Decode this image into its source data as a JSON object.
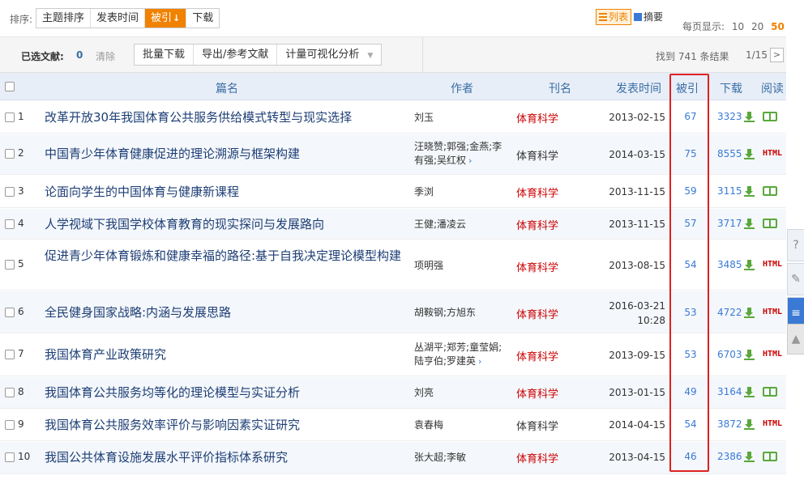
{
  "sortbar": {
    "label": "排序:",
    "buttons": [
      {
        "label": "主题排序",
        "active": false
      },
      {
        "label": "发表时间",
        "active": false
      },
      {
        "label": "被引",
        "active": true,
        "arrow": "↓"
      },
      {
        "label": "下载",
        "active": false
      }
    ],
    "view_list": "列表",
    "view_abstract": "摘要",
    "per_page_label": "每页显示:",
    "per_page_options": [
      "10",
      "20",
      "50"
    ],
    "per_page_selected": "50"
  },
  "selbar": {
    "selected_label": "已选文献:",
    "selected_count": "0",
    "clear": "清除",
    "actions": [
      "批量下载",
      "导出/参考文献",
      "计量可视化分析"
    ],
    "found": "找到 741 条结果",
    "page": "1/15",
    "next": ">"
  },
  "table": {
    "headers": {
      "title": "篇名",
      "author": "作者",
      "journal": "刊名",
      "date": "发表时间",
      "cited": "被引",
      "download": "下载",
      "read": "阅读"
    },
    "rows": [
      {
        "num": "1",
        "title": "改革开放30年我国体育公共服务供给模式转型与现实选择",
        "authors": "刘玉",
        "journal": "体育科学",
        "journal_red": true,
        "date": "2013-02-15",
        "cited": "67",
        "downloads": "3323",
        "read": "book"
      },
      {
        "num": "2",
        "title": "中国青少年体育健康促进的理论溯源与框架构建",
        "authors": "汪晓赞;郭强;金燕;李有强;吴红权",
        "more": true,
        "journal": "体育科学",
        "journal_red": false,
        "date": "2014-03-15",
        "cited": "75",
        "downloads": "8555",
        "read": "HTML"
      },
      {
        "num": "3",
        "title": "论面向学生的中国体育与健康新课程",
        "authors": "季浏",
        "journal": "体育科学",
        "journal_red": true,
        "date": "2013-11-15",
        "cited": "59",
        "downloads": "3115",
        "read": "book"
      },
      {
        "num": "4",
        "title": "人学视域下我国学校体育教育的现实探问与发展路向",
        "authors": "王健;潘凌云",
        "journal": "体育科学",
        "journal_red": true,
        "date": "2013-11-15",
        "cited": "57",
        "downloads": "3717",
        "read": "book"
      },
      {
        "num": "5",
        "title": "促进青少年体育锻炼和健康幸福的路径:基于自我决定理论模型构建",
        "authors": "项明强",
        "journal": "体育科学",
        "journal_red": true,
        "date": "2013-08-15",
        "cited": "54",
        "downloads": "3485",
        "read": "HTML"
      },
      {
        "num": "6",
        "title": "全民健身国家战略:内涵与发展思路",
        "authors": "胡鞍钢;方旭东",
        "journal": "体育科学",
        "journal_red": true,
        "date": "2016-03-21",
        "date2": "10:28",
        "cited": "53",
        "downloads": "4722",
        "read": "HTML"
      },
      {
        "num": "7",
        "title": "我国体育产业政策研究",
        "authors": "丛湖平;郑芳;童莹娟;陆亨伯;罗建英",
        "more": true,
        "journal": "体育科学",
        "journal_red": true,
        "date": "2013-09-15",
        "cited": "53",
        "downloads": "6703",
        "read": "HTML"
      },
      {
        "num": "8",
        "title": "我国体育公共服务均等化的理论模型与实证分析",
        "authors": "刘亮",
        "journal": "体育科学",
        "journal_red": true,
        "date": "2013-01-15",
        "cited": "49",
        "downloads": "3164",
        "read": "book"
      },
      {
        "num": "9",
        "title": "我国体育公共服务效率评价与影响因素实证研究",
        "authors": "袁春梅",
        "journal": "体育科学",
        "journal_red": false,
        "date": "2014-04-15",
        "cited": "54",
        "downloads": "3872",
        "read": "HTML"
      },
      {
        "num": "10",
        "title": "我国公共体育设施发展水平评价指标体系研究",
        "authors": "张大超;李敏",
        "journal": "体育科学",
        "journal_red": true,
        "date": "2013-04-15",
        "cited": "46",
        "downloads": "2386",
        "read": "book"
      }
    ]
  },
  "colors": {
    "accent": "#f08200",
    "link": "#1d3e75",
    "journal_red": "#cc0000",
    "highlight": "#e02020",
    "header_bg": "#e8eef8"
  },
  "side_tools": [
    "comment-icon",
    "edit-icon",
    "note-icon"
  ],
  "scroll_top_icon": "arrow-up-icon"
}
